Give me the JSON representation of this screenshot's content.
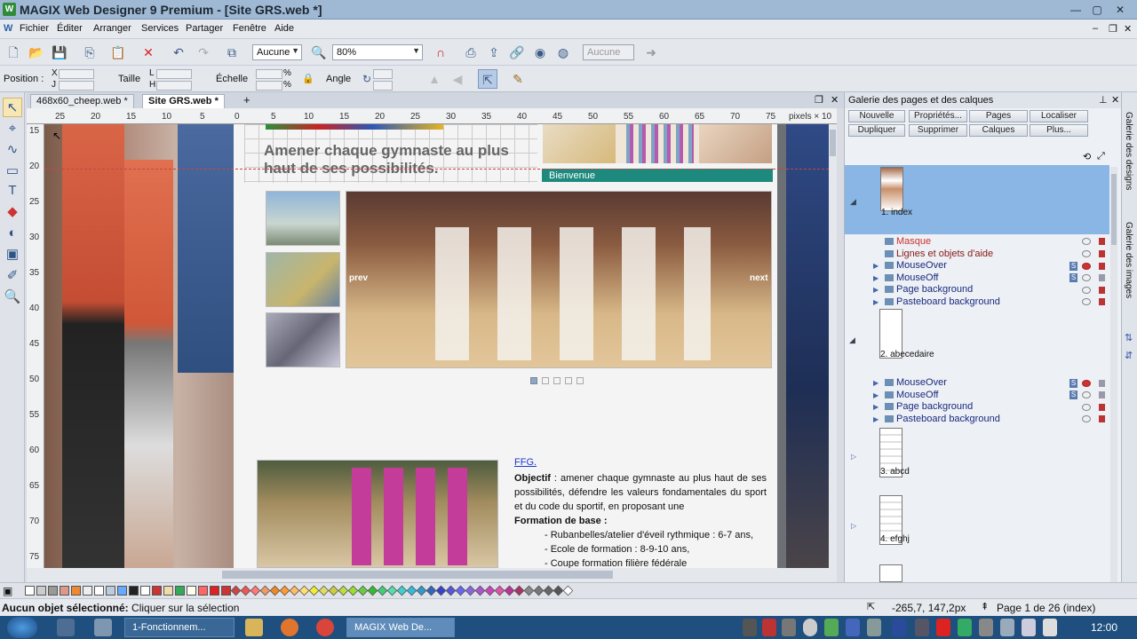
{
  "titlebar": {
    "title": "MAGIX Web Designer 9 Premium - [Site GRS.web *]"
  },
  "menu": [
    "Fichier",
    "Éditer",
    "Arranger",
    "Services",
    "Partager",
    "Fenêtre",
    "Aide"
  ],
  "toolbar": {
    "style_combo": "Aucune",
    "zoom_combo": "80%",
    "disabled_combo": "Aucune"
  },
  "propbar": {
    "position": "Position :",
    "x": "X",
    "y": "J",
    "size": "Taille",
    "l1": "L",
    "l2": "H",
    "scale": "Échelle",
    "pct": "%",
    "angle": "Angle"
  },
  "tabs": [
    "468x60_cheep.web *",
    "Site GRS.web *"
  ],
  "hruler": {
    "ticks": [
      "25",
      "20",
      "15",
      "10",
      "5",
      "0",
      "5",
      "10",
      "15",
      "20",
      "25",
      "30",
      "35",
      "40",
      "45",
      "50",
      "55",
      "60",
      "65",
      "70",
      "75"
    ],
    "unit": "pixels × 10"
  },
  "vruler": {
    "ticks": [
      "15",
      "20",
      "25",
      "30",
      "35",
      "40",
      "45",
      "50",
      "55",
      "60",
      "65",
      "70",
      "75"
    ]
  },
  "website": {
    "heading": "Amener chaque gymnaste au plus haut de ses possibilités.",
    "nav": "Bienvenue",
    "slider_prev": "prev",
    "slider_next": "next",
    "ffg_link": "FFG.",
    "objectif_label": "Objectif",
    "objectif_text": " : amener chaque gymnaste au plus haut de ses possibilités, défendre les valeurs fondamentales du sport et du code du sportif, en proposant une",
    "formation_label": "Formation de base :",
    "items": [
      "- Rubanbelles/atelier d'éveil rythmique : 6-7 ans,",
      "- Ecole de formation : 8-9-10 ans,",
      "- Coupe formation filière fédérale"
    ]
  },
  "panel": {
    "title": "Galerie des pages et des calques",
    "buttons_row1": [
      "Nouvelle page",
      "Propriétés...",
      "Pages",
      "Localiser"
    ],
    "buttons_row2": [
      "Dupliquer",
      "Supprimer",
      "Calques",
      "Plus..."
    ],
    "pages": [
      {
        "name": "1. index",
        "layers": [
          "Masque",
          "Lignes et objets d'aide",
          "MouseOver",
          "MouseOff",
          "Page background",
          "Pasteboard background"
        ]
      },
      {
        "name": "2. abecedaire",
        "layers": [
          "MouseOver",
          "MouseOff",
          "Page background",
          "Pasteboard background"
        ]
      },
      {
        "name": "3. abcd"
      },
      {
        "name": "4. efghj"
      }
    ],
    "side_tabs": [
      "Galerie des designs",
      "Galerie des images"
    ]
  },
  "status": {
    "selection_label": "Aucun objet sélectionné:",
    "selection_hint": " Cliquer sur la sélection",
    "coords": "-265,7, 147,2px",
    "page": "Page 1 de 26 (index)"
  },
  "taskbar": {
    "items": [
      "1-Fonctionnem...",
      "MAGIX Web De..."
    ],
    "time": "12:00"
  },
  "colors": {
    "accent": "#1e8a7e",
    "selected_page": "#8ab6e6",
    "titlebar": "#9fb9d4"
  }
}
